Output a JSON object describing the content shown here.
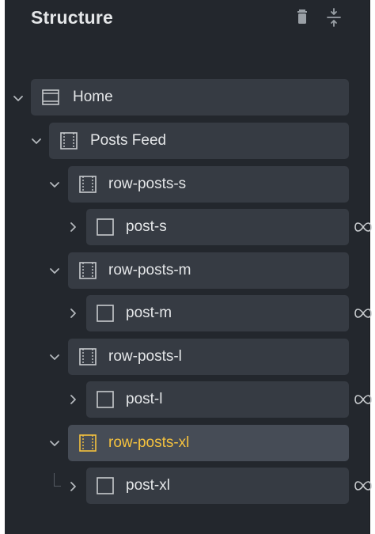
{
  "panel": {
    "title": "Structure",
    "actions": {
      "delete_icon": "trash-icon",
      "collapse_icon": "collapse-expand-icon"
    }
  },
  "tree": {
    "nodes": [
      {
        "label": "Home",
        "icon": "page-icon",
        "expanded": true,
        "active": false
      },
      {
        "label": "Posts Feed",
        "icon": "section-icon",
        "expanded": true,
        "active": false
      },
      {
        "label": "row-posts-s",
        "icon": "row-icon",
        "expanded": true,
        "active": false
      },
      {
        "label": "post-s",
        "icon": "box-icon",
        "expanded": false,
        "active": false,
        "linked": true
      },
      {
        "label": "row-posts-m",
        "icon": "row-icon",
        "expanded": true,
        "active": false
      },
      {
        "label": "post-m",
        "icon": "box-icon",
        "expanded": false,
        "active": false,
        "linked": true
      },
      {
        "label": "row-posts-l",
        "icon": "row-icon",
        "expanded": true,
        "active": false
      },
      {
        "label": "post-l",
        "icon": "box-icon",
        "expanded": false,
        "active": false,
        "linked": true
      },
      {
        "label": "row-posts-xl",
        "icon": "row-icon",
        "expanded": true,
        "active": true
      },
      {
        "label": "post-xl",
        "icon": "box-icon",
        "expanded": false,
        "active": false,
        "linked": true
      }
    ],
    "link_icon": "infinity-link-icon"
  },
  "colors": {
    "panel_bg": "#23272d",
    "node_bg": "#363b43",
    "node_active_bg": "#464c56",
    "text": "#e4e6e8",
    "active_text": "#f5c23e"
  }
}
